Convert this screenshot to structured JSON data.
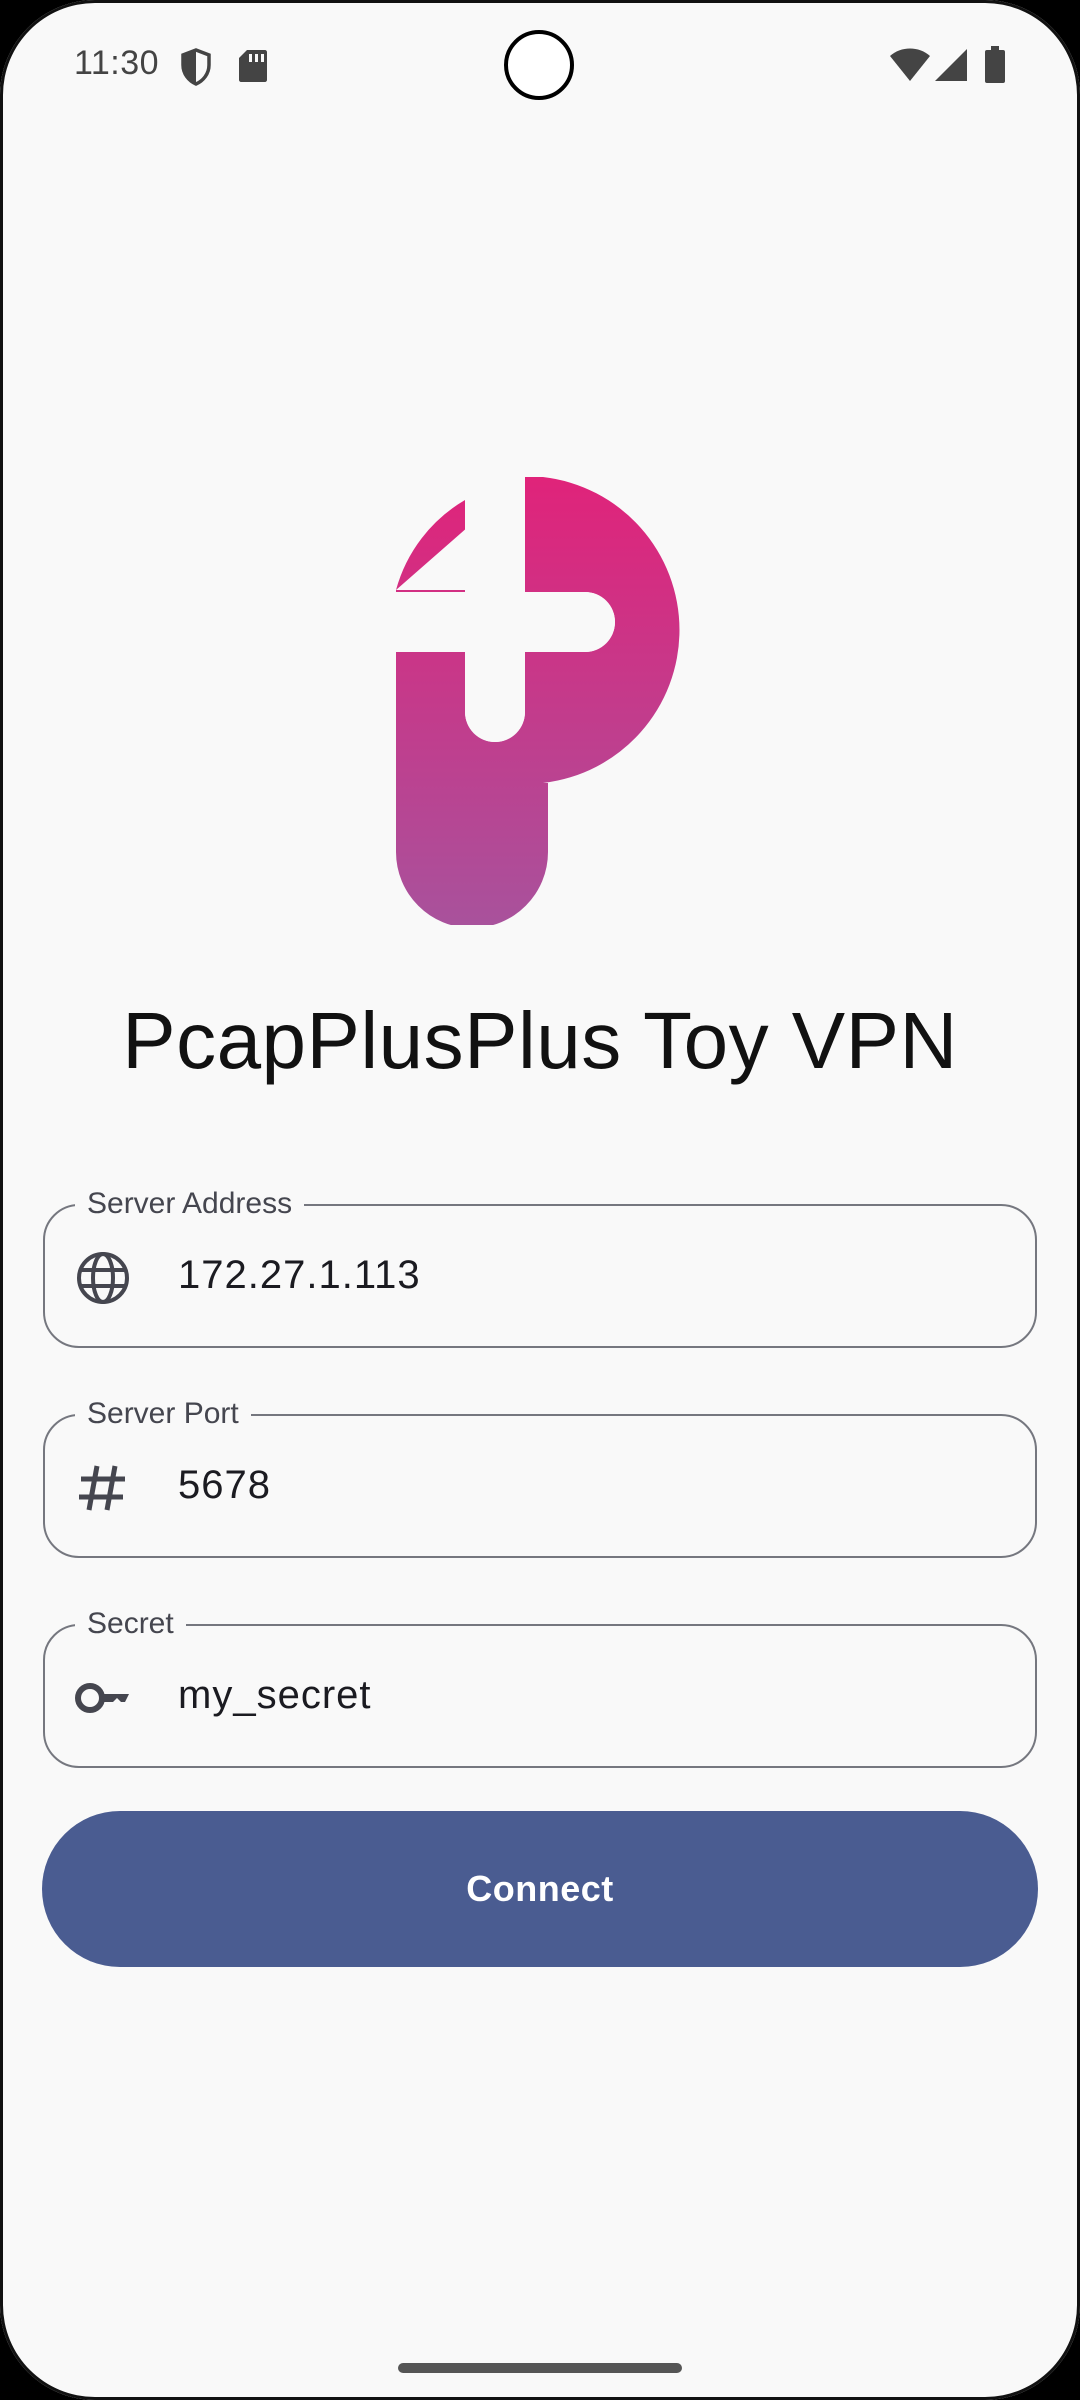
{
  "status_bar": {
    "time": "11:30",
    "left_icons": [
      "shield-icon",
      "sd-card-icon"
    ],
    "right_icons": [
      "wifi-icon",
      "cell-signal-icon",
      "battery-icon"
    ]
  },
  "app": {
    "title": "PcapPlusPlus Toy VPN",
    "logo": "pcapplusplus-logo",
    "logo_gradient": [
      "#e0237a",
      "#a8529c"
    ]
  },
  "form": {
    "server_address": {
      "label": "Server Address",
      "value": "172.27.1.113",
      "icon": "globe-icon"
    },
    "server_port": {
      "label": "Server Port",
      "value": "5678",
      "icon": "hash-icon"
    },
    "secret": {
      "label": "Secret",
      "value": "my_secret",
      "icon": "key-icon"
    }
  },
  "connect_button": {
    "label": "Connect",
    "color": "#4a5c91"
  }
}
